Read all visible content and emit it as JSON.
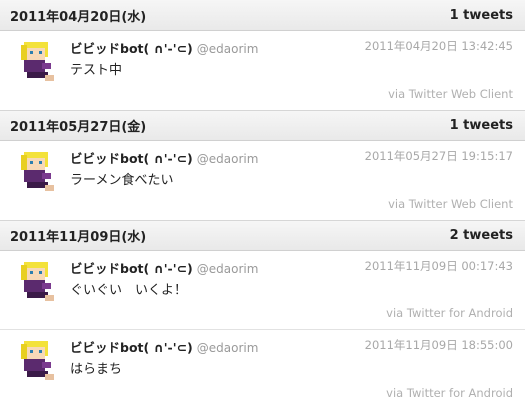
{
  "groups": [
    {
      "date": "2011年04月20日(水)",
      "count": "1 tweets",
      "tweets": [
        {
          "name": "ビビッドbot( ∩'-'⊂)",
          "screen_name": "@edaorim",
          "time": "2011年04月20日 13:42:45",
          "text": "テスト中",
          "via": "via Twitter Web Client"
        }
      ]
    },
    {
      "date": "2011年05月27日(金)",
      "count": "1 tweets",
      "tweets": [
        {
          "name": "ビビッドbot( ∩'-'⊂)",
          "screen_name": "@edaorim",
          "time": "2011年05月27日 19:15:17",
          "text": "ラーメン食べたい",
          "via": "via Twitter Web Client"
        }
      ]
    },
    {
      "date": "2011年11月09日(水)",
      "count": "2 tweets",
      "tweets": [
        {
          "name": "ビビッドbot( ∩'-'⊂)",
          "screen_name": "@edaorim",
          "time": "2011年11月09日 00:17:43",
          "text": "ぐいぐい　いくよ！",
          "via": "via Twitter for Android"
        },
        {
          "name": "ビビッドbot( ∩'-'⊂)",
          "screen_name": "@edaorim",
          "time": "2011年11月09日 18:55:00",
          "text": "はらまち",
          "via": "via Twitter for Android"
        }
      ]
    }
  ],
  "colors": {
    "header_bg": "#ececec",
    "muted_text": "#a8a8a8",
    "avatar_hair": "#f3e23a",
    "avatar_outfit": "#5b2a6e"
  },
  "icons": {
    "avatar": "pixel-character-avatar"
  }
}
